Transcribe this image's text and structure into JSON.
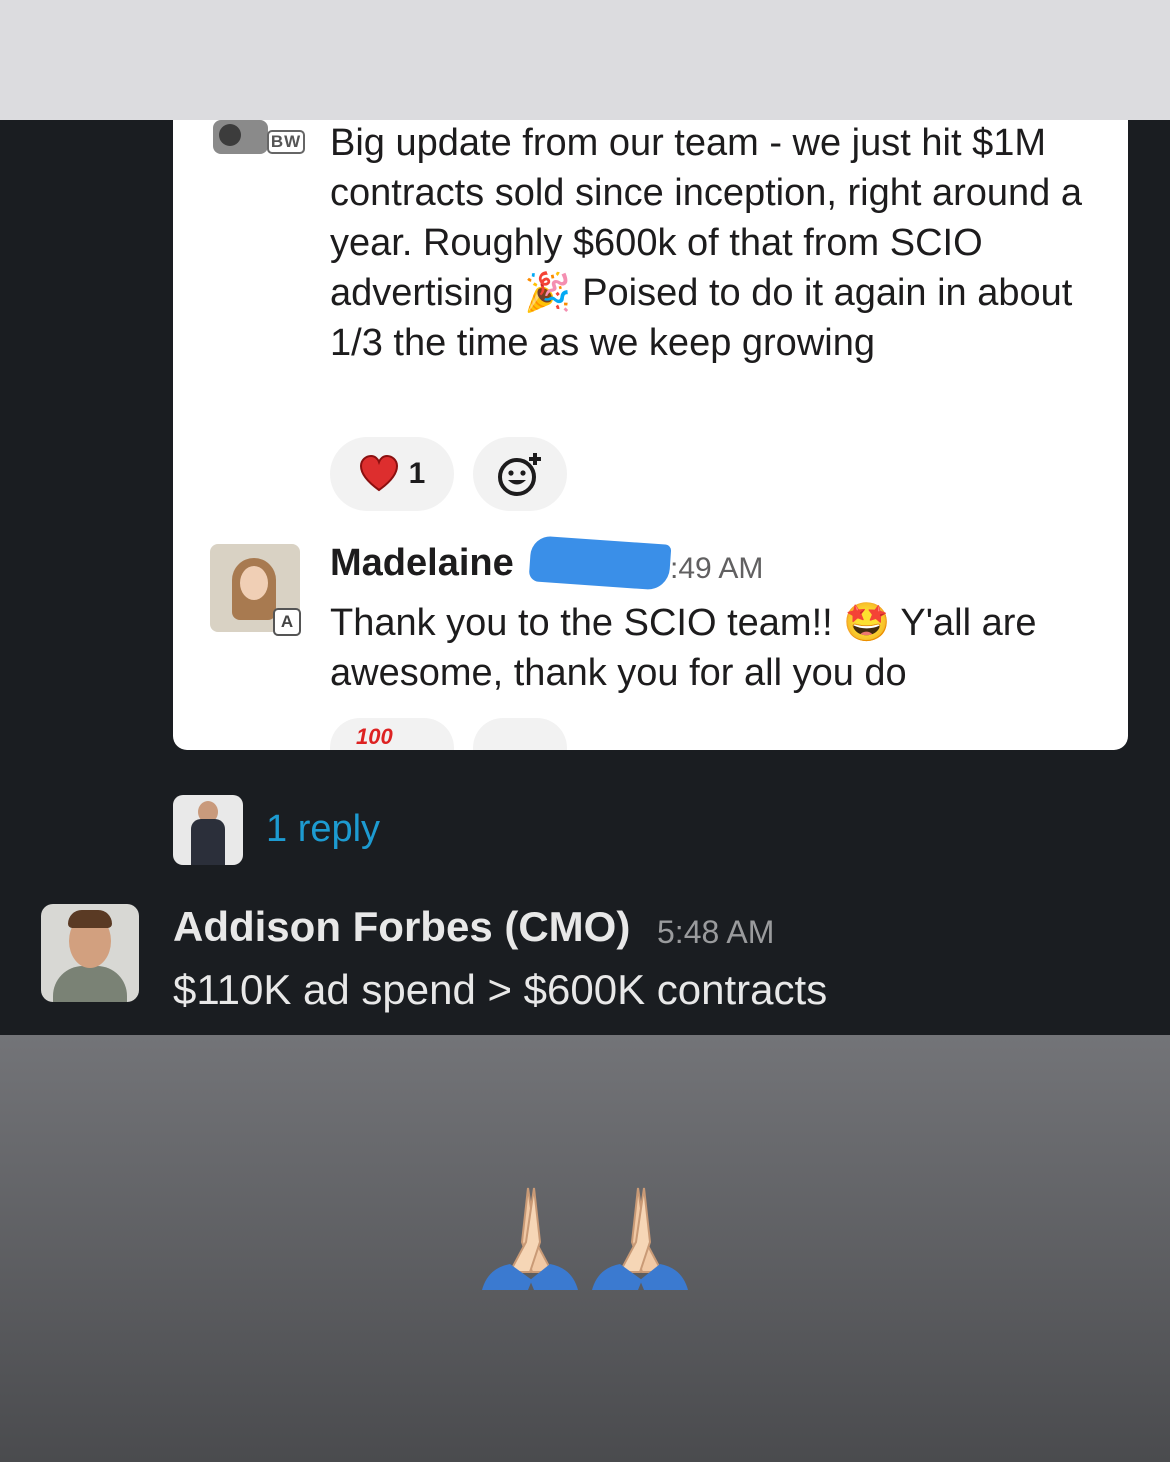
{
  "quoted_card": {
    "badge_bw": "BW",
    "message_1": "Big update from our team - we just hit $1M contracts sold since inception, right around a year. Roughly $600k of that from SCIO advertising 🎉 Poised to do it again in about 1/3 the time as we keep growing",
    "reaction_heart_count": "1",
    "reply": {
      "author": "Madelaine",
      "badge": "A",
      "time": ":49 AM",
      "text": "Thank you to the SCIO team!! 🤩 Y'all are awesome, thank you for all you do"
    },
    "cut_reaction_label": "100"
  },
  "thread": {
    "reply_count": "1 reply"
  },
  "message": {
    "author": "Addison Forbes (CMO)",
    "time": "5:48 AM",
    "text": "$110K ad spend > $600K contracts"
  },
  "caption": {
    "emoji": "🙏🙏",
    "icon": "praying-hands-icon"
  },
  "colors": {
    "dark_bg": "#1a1d21",
    "link_blue": "#1d9bd1",
    "redaction_blue": "#3a8fe8"
  }
}
